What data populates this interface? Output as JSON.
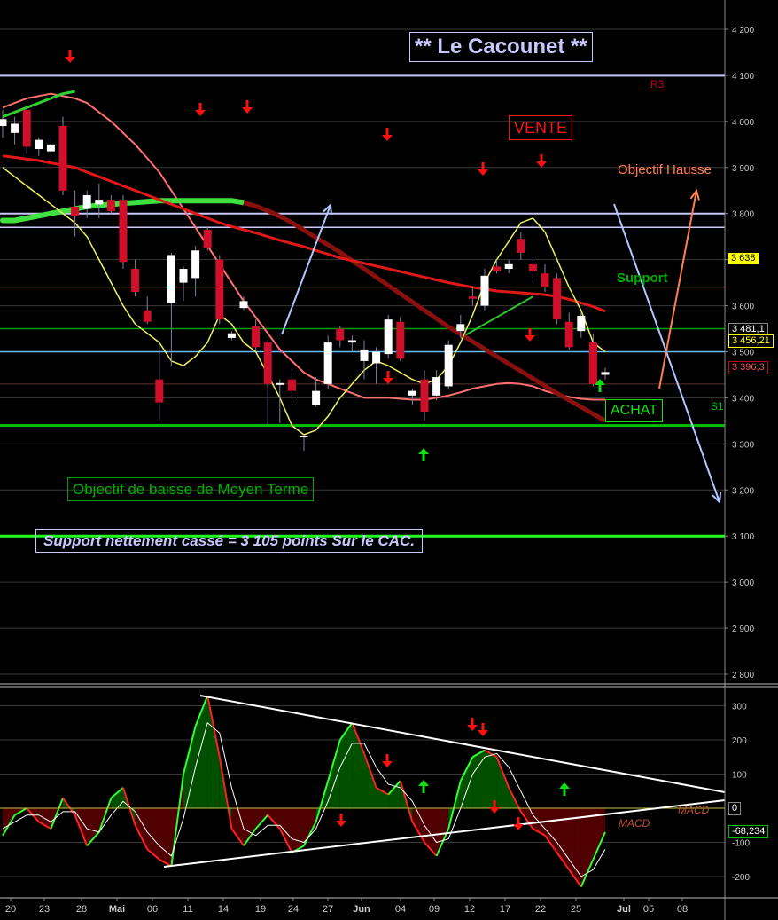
{
  "title": "** Le Cacounet **",
  "colors": {
    "background": "#000000",
    "grid": "#3a3a3a",
    "bull_candle": "#ffffff",
    "bear_candle": "#d0102a",
    "resistance_line": "#c8c8ff",
    "support_line": "#00c000",
    "sell_arrow": "#ff1010",
    "buy_arrow": "#10e010",
    "macd_positive_fill": "#005000",
    "macd_negative_fill": "#500000"
  },
  "labels": {
    "vente": "VENTE",
    "achat": "ACHAT",
    "objectif_hausse": "Objectif Hausse",
    "support": "Support",
    "r3": "R3",
    "s1": "S1",
    "objectif_baisse": "Objectif de baisse de Moyen Terme",
    "support_casse": "Support nettement cassé = 3 105 points Sur le CAC.",
    "macd_label_1": "MACD",
    "macd_label_2": "MACD"
  },
  "price_badges": {
    "ma_level": "3 638",
    "last_high": "3 481,1",
    "last_close": "3 456,21",
    "lower_band": "3 396,3"
  },
  "macd_badges": {
    "zero": "0",
    "macd_value": "-68,234"
  },
  "chart_data": [
    {
      "type": "candlestick",
      "yrange": [
        2790,
        4260
      ],
      "yticks": [
        2800,
        2900,
        3000,
        3100,
        3200,
        3300,
        3400,
        3500,
        3600,
        3700,
        3800,
        3900,
        4000,
        4100,
        4200
      ],
      "ytick_labels": [
        "2 800",
        "2 900",
        "3 000",
        "3 100",
        "3 200",
        "3 300",
        "3 400",
        "3 500",
        "3 600",
        "3 700",
        "3 800",
        "3 900",
        "4 000",
        "4 100",
        "4 200"
      ],
      "xtick_labels": [
        "20",
        "23",
        "28",
        "Mai",
        "06",
        "11",
        "14",
        "19",
        "24",
        "27",
        "Jun",
        "04",
        "09",
        "12",
        "17",
        "22",
        "25",
        "Jul",
        "05",
        "08"
      ],
      "candles": [
        {
          "o": 3990,
          "h": 4025,
          "l": 3965,
          "c": 4005
        },
        {
          "o": 3975,
          "h": 4010,
          "l": 3950,
          "c": 3995
        },
        {
          "o": 4025,
          "h": 4030,
          "l": 3930,
          "c": 3945
        },
        {
          "o": 3940,
          "h": 3965,
          "l": 3925,
          "c": 3960
        },
        {
          "o": 3935,
          "h": 3970,
          "l": 3930,
          "c": 3950
        },
        {
          "o": 3990,
          "h": 4010,
          "l": 3840,
          "c": 3850
        },
        {
          "o": 3815,
          "h": 3850,
          "l": 3750,
          "c": 3795
        },
        {
          "o": 3810,
          "h": 3850,
          "l": 3790,
          "c": 3840
        },
        {
          "o": 3820,
          "h": 3865,
          "l": 3790,
          "c": 3830
        },
        {
          "o": 3830,
          "h": 3840,
          "l": 3800,
          "c": 3805
        },
        {
          "o": 3830,
          "h": 3840,
          "l": 3680,
          "c": 3695
        },
        {
          "o": 3680,
          "h": 3700,
          "l": 3620,
          "c": 3630
        },
        {
          "o": 3590,
          "h": 3620,
          "l": 3560,
          "c": 3565
        },
        {
          "o": 3440,
          "h": 3520,
          "l": 3350,
          "c": 3390
        },
        {
          "o": 3605,
          "h": 3715,
          "l": 3470,
          "c": 3710
        },
        {
          "o": 3650,
          "h": 3685,
          "l": 3610,
          "c": 3680
        },
        {
          "o": 3660,
          "h": 3730,
          "l": 3620,
          "c": 3720
        },
        {
          "o": 3765,
          "h": 3770,
          "l": 3720,
          "c": 3725
        },
        {
          "o": 3700,
          "h": 3710,
          "l": 3560,
          "c": 3570
        },
        {
          "o": 3530,
          "h": 3545,
          "l": 3525,
          "c": 3540
        },
        {
          "o": 3595,
          "h": 3620,
          "l": 3590,
          "c": 3610
        },
        {
          "o": 3555,
          "h": 3570,
          "l": 3505,
          "c": 3510
        },
        {
          "o": 3520,
          "h": 3525,
          "l": 3340,
          "c": 3430
        },
        {
          "o": 3430,
          "h": 3440,
          "l": 3345,
          "c": 3432
        },
        {
          "o": 3440,
          "h": 3460,
          "l": 3395,
          "c": 3415
        },
        {
          "o": 3315,
          "h": 3320,
          "l": 3285,
          "c": 3318
        },
        {
          "o": 3385,
          "h": 3445,
          "l": 3380,
          "c": 3415
        },
        {
          "o": 3430,
          "h": 3535,
          "l": 3420,
          "c": 3520
        },
        {
          "o": 3550,
          "h": 3555,
          "l": 3510,
          "c": 3525
        },
        {
          "o": 3520,
          "h": 3535,
          "l": 3500,
          "c": 3525
        },
        {
          "o": 3480,
          "h": 3525,
          "l": 3440,
          "c": 3505
        },
        {
          "o": 3475,
          "h": 3510,
          "l": 3430,
          "c": 3500
        },
        {
          "o": 3495,
          "h": 3580,
          "l": 3485,
          "c": 3570
        },
        {
          "o": 3565,
          "h": 3575,
          "l": 3480,
          "c": 3485
        },
        {
          "o": 3405,
          "h": 3420,
          "l": 3385,
          "c": 3415
        },
        {
          "o": 3440,
          "h": 3460,
          "l": 3350,
          "c": 3370
        },
        {
          "o": 3405,
          "h": 3460,
          "l": 3395,
          "c": 3445
        },
        {
          "o": 3425,
          "h": 3525,
          "l": 3420,
          "c": 3515
        },
        {
          "o": 3545,
          "h": 3580,
          "l": 3530,
          "c": 3560
        },
        {
          "o": 3620,
          "h": 3640,
          "l": 3600,
          "c": 3615
        },
        {
          "o": 3600,
          "h": 3680,
          "l": 3590,
          "c": 3665
        },
        {
          "o": 3685,
          "h": 3700,
          "l": 3670,
          "c": 3675
        },
        {
          "o": 3680,
          "h": 3700,
          "l": 3670,
          "c": 3690
        },
        {
          "o": 3745,
          "h": 3760,
          "l": 3700,
          "c": 3715
        },
        {
          "o": 3690,
          "h": 3705,
          "l": 3650,
          "c": 3675
        },
        {
          "o": 3670,
          "h": 3690,
          "l": 3630,
          "c": 3640
        },
        {
          "o": 3660,
          "h": 3670,
          "l": 3560,
          "c": 3570
        },
        {
          "o": 3565,
          "h": 3585,
          "l": 3505,
          "c": 3510
        },
        {
          "o": 3545,
          "h": 3585,
          "l": 3530,
          "c": 3578
        },
        {
          "o": 3520,
          "h": 3540,
          "l": 3425,
          "c": 3430
        },
        {
          "o": 3450,
          "h": 3465,
          "l": 3440,
          "c": 3456
        }
      ],
      "lower_band": [
        3980,
        3960,
        3945,
        3920,
        3900,
        3870,
        3840,
        3810,
        3790,
        3770,
        3740,
        3710,
        3690,
        3670,
        3650,
        3640,
        3620,
        3600,
        3580,
        3560,
        3540,
        3520,
        3500,
        3480,
        3470,
        3460,
        3460,
        3460,
        3460,
        3460,
        3460,
        3460,
        3470,
        3480,
        3490,
        3500,
        3510,
        3520,
        3530,
        3545,
        3560,
        3575,
        3590,
        3605,
        3620,
        3630,
        3630,
        3630,
        3625,
        3618,
        3612
      ],
      "yellow_ma": [
        3900,
        3880,
        3860,
        3840,
        3820,
        3800,
        3780,
        3750,
        3700,
        3650,
        3600,
        3560,
        3540,
        3520,
        3480,
        3470,
        3490,
        3520,
        3580,
        3560,
        3520,
        3500,
        3450,
        3400,
        3340,
        3320,
        3330,
        3360,
        3400,
        3430,
        3460,
        3480,
        3470,
        3455,
        3440,
        3430,
        3440,
        3470,
        3520,
        3580,
        3650,
        3700,
        3740,
        3780,
        3790,
        3760,
        3700,
        3640,
        3590,
        3520,
        3500
      ],
      "annotations": {
        "resistance_r3": 4100,
        "objectif_hausse": 3800,
        "resistance_2": 3770,
        "support": 3550,
        "pivot_blue": 3500,
        "s1": 3340,
        "objectif_baisse": 3100
      }
    },
    {
      "type": "macd",
      "yrange": [
        -240,
        350
      ],
      "yticks": [
        -200,
        -100,
        0,
        100,
        200,
        300
      ],
      "ytick_labels": [
        "-200",
        "-100",
        "0",
        "100",
        "200",
        "300"
      ],
      "macd": [
        -80,
        -20,
        0,
        -40,
        -60,
        30,
        -20,
        -110,
        -70,
        30,
        60,
        -50,
        -120,
        -150,
        -170,
        100,
        240,
        330,
        150,
        -60,
        -110,
        -60,
        -20,
        -60,
        -130,
        -110,
        -40,
        80,
        200,
        250,
        160,
        60,
        40,
        80,
        -40,
        -100,
        -140,
        -60,
        80,
        150,
        170,
        150,
        60,
        -10,
        -60,
        -80,
        -130,
        -180,
        -230,
        -150,
        -70
      ],
      "signal": [
        -60,
        -40,
        -20,
        -20,
        -40,
        -10,
        -10,
        -60,
        -70,
        -20,
        20,
        -10,
        -70,
        -110,
        -140,
        -30,
        120,
        250,
        220,
        60,
        -60,
        -80,
        -50,
        -50,
        -90,
        -100,
        -60,
        20,
        120,
        190,
        190,
        120,
        70,
        60,
        20,
        -50,
        -100,
        -90,
        0,
        100,
        150,
        160,
        120,
        50,
        -20,
        -60,
        -100,
        -150,
        -200,
        -180,
        -120
      ]
    }
  ]
}
